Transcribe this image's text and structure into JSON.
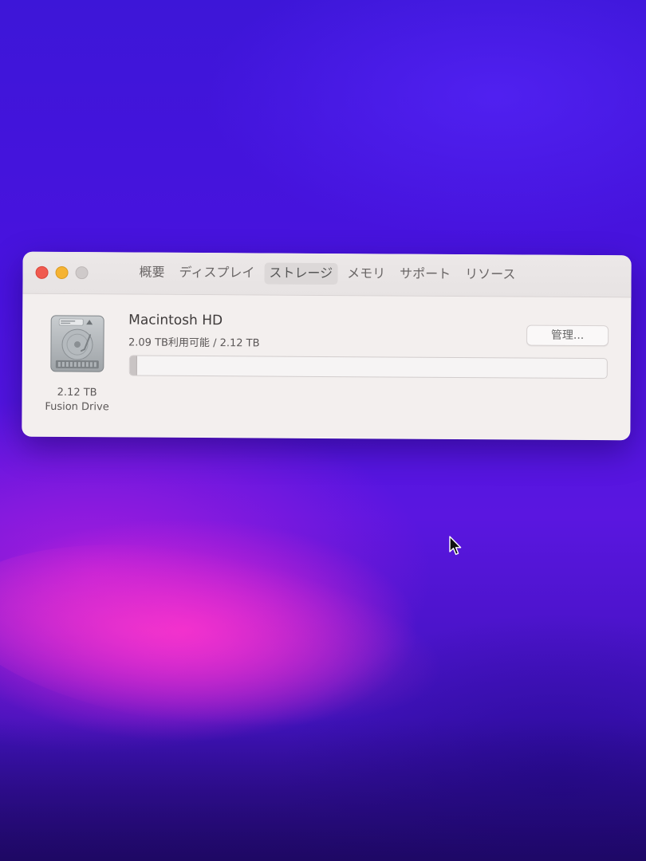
{
  "window": {
    "tabs": [
      {
        "label": "概要"
      },
      {
        "label": "ディスプレイ"
      },
      {
        "label": "ストレージ"
      },
      {
        "label": "メモリ"
      },
      {
        "label": "サポート"
      },
      {
        "label": "リソース"
      }
    ],
    "active_tab": "ストレージ"
  },
  "storage": {
    "disk_icon": "hard-drive-icon",
    "disk_size": "2.12 TB",
    "disk_type": "Fusion Drive",
    "volume_name": "Macintosh HD",
    "usage_text": "2.09 TB利用可能 / 2.12 TB",
    "used_fraction": 0.014,
    "manage_label": "管理..."
  },
  "colors": {
    "close": "#f05a4f",
    "minimize": "#f5b332",
    "zoom_inactive": "#cfcaca",
    "window_bg": "#f3efee",
    "wallpaper_primary": "#4a12df",
    "wallpaper_accent": "#ec28d2"
  }
}
